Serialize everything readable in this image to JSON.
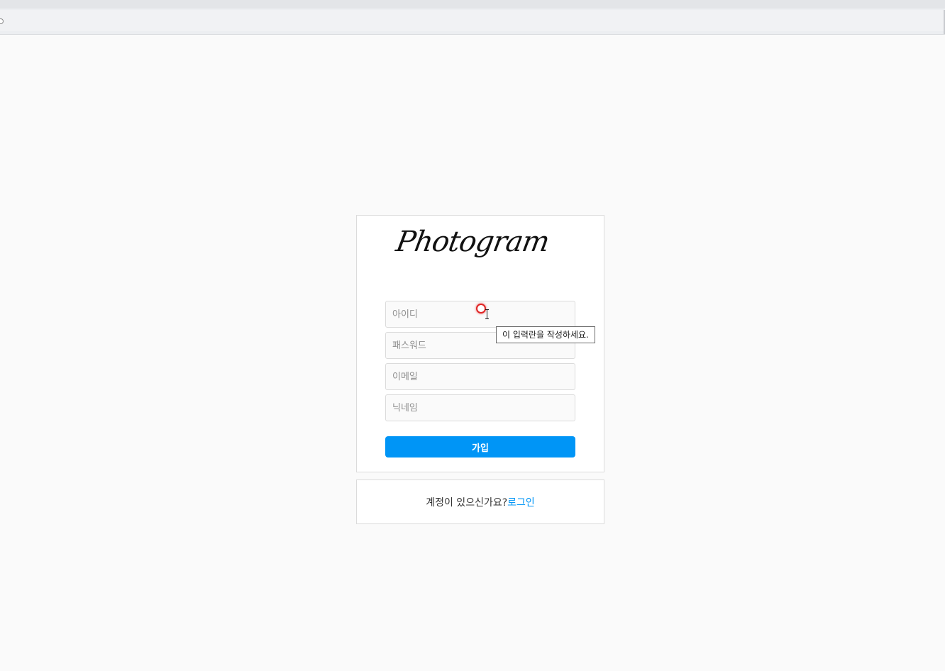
{
  "brand": {
    "logo_text": "Photogram"
  },
  "join_form": {
    "username_placeholder": "아이디",
    "password_placeholder": "패스워드",
    "email_placeholder": "이메일",
    "nickname_placeholder": "닉네임",
    "submit_label": "가입"
  },
  "validation_tooltip": {
    "text": "이 입력란을 작성하세요."
  },
  "login_prompt": {
    "question": "계정이 있으신가요?",
    "link_label": "로그인"
  },
  "colors": {
    "accent": "#0095f6",
    "background": "#fafafa",
    "card_border": "#dbdbdb"
  }
}
